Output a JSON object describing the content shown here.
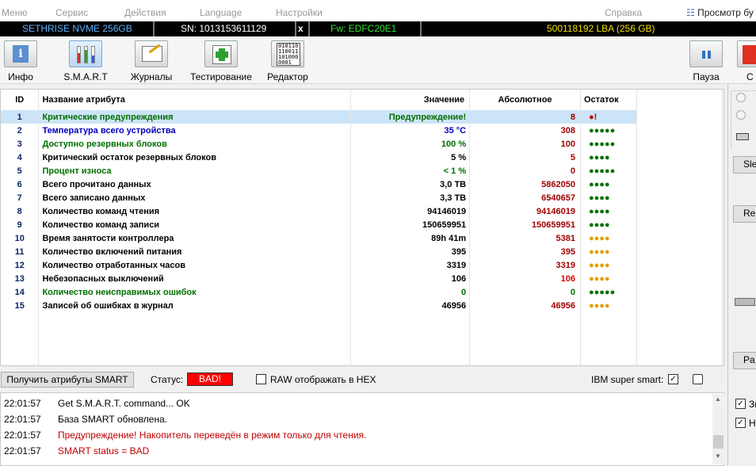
{
  "menu": {
    "items": [
      "Меню",
      "Сервис",
      "Действия",
      "Language",
      "Настройки"
    ],
    "help": "Справка",
    "view": "Просмотр бу"
  },
  "device": {
    "model": "SETHRISE NVME 256GB",
    "sn": "SN: 1013153611129",
    "close": "x",
    "fw": "Fw: EDFC20E1",
    "lba": "500118192 LBA (256 GB)"
  },
  "toolbar": {
    "info": "Инфо",
    "smart": "S.M.A.R.T",
    "journals": "Журналы",
    "testing": "Тестирование",
    "editor": "Редактор",
    "pause": "Пауза",
    "stop": "С"
  },
  "table": {
    "headers": {
      "id": "ID",
      "name": "Название атрибута",
      "value": "Значение",
      "abs": "Абсолютное",
      "rest": "Остаток"
    },
    "rows": [
      {
        "id": "1",
        "name": "Критические предупреждения",
        "value": "Предупреждение!",
        "abs": "8",
        "rest": "●!",
        "nc": "#007000",
        "vc": "#007000",
        "dc": "#c00000"
      },
      {
        "id": "2",
        "name": "Температура всего устройства",
        "value": "35 °C",
        "abs": "308",
        "rest": "●●●●●",
        "nc": "#0000c0",
        "vc": "#0000c0",
        "dc": "#007000"
      },
      {
        "id": "3",
        "name": "Доступно резервных блоков",
        "value": "100 %",
        "abs": "100",
        "rest": "●●●●●",
        "nc": "#007000",
        "vc": "#007000",
        "dc": "#007000"
      },
      {
        "id": "4",
        "name": "Критический остаток резервных блоков",
        "value": "5 %",
        "abs": "5",
        "rest": "●●●●",
        "nc": "#000",
        "vc": "#000",
        "dc": "#007000"
      },
      {
        "id": "5",
        "name": "Процент износа",
        "value": "< 1 %",
        "abs": "0",
        "rest": "●●●●●",
        "nc": "#007000",
        "vc": "#007000",
        "dc": "#007000"
      },
      {
        "id": "6",
        "name": "Всего прочитано данных",
        "value": "3,0 ТВ",
        "abs": "5862050",
        "rest": "●●●●",
        "nc": "#000",
        "vc": "#000",
        "dc": "#007000"
      },
      {
        "id": "7",
        "name": "Всего записано данных",
        "value": "3,3 ТВ",
        "abs": "6540657",
        "rest": "●●●●",
        "nc": "#000",
        "vc": "#000",
        "dc": "#007000"
      },
      {
        "id": "8",
        "name": "Количество команд чтения",
        "value": "94146019",
        "abs": "94146019",
        "rest": "●●●●",
        "nc": "#000",
        "vc": "#000",
        "dc": "#007000"
      },
      {
        "id": "9",
        "name": "Количество команд записи",
        "value": "150659951",
        "abs": "150659951",
        "rest": "●●●●",
        "nc": "#000",
        "vc": "#000",
        "dc": "#007000"
      },
      {
        "id": "10",
        "name": "Время занятости контроллера",
        "value": "89h 41m",
        "abs": "5381",
        "rest": "●●●●",
        "nc": "#000",
        "vc": "#000",
        "dc": "#e0a000"
      },
      {
        "id": "11",
        "name": "Количество включений питания",
        "value": "395",
        "abs": "395",
        "rest": "●●●●",
        "nc": "#000",
        "vc": "#000",
        "dc": "#e0a000"
      },
      {
        "id": "12",
        "name": "Количество отработанных часов",
        "value": "3319",
        "abs": "3319",
        "rest": "●●●●",
        "nc": "#000",
        "vc": "#000",
        "dc": "#e0a000"
      },
      {
        "id": "13",
        "name": "Небезопасных выключений",
        "value": "106",
        "abs": "106",
        "rest": "●●●●",
        "nc": "#000",
        "vc": "#000",
        "dc": "#e0a000",
        "ac": "#e00000"
      },
      {
        "id": "14",
        "name": "Количество неисправимых ошибок",
        "value": "0",
        "abs": "0",
        "rest": "●●●●●",
        "nc": "#007000",
        "vc": "#007000",
        "dc": "#007000",
        "ac": "#007000"
      },
      {
        "id": "15",
        "name": "Записей об ошибках в журнал",
        "value": "46956",
        "abs": "46956",
        "rest": "●●●●",
        "nc": "#000",
        "vc": "#000",
        "dc": "#e0a000"
      }
    ]
  },
  "status": {
    "get_button": "Получить атрибуты SMART",
    "label": "Статус:",
    "value": "BAD!",
    "raw_hex": "RAW отображать в HEX",
    "ibm": "IBM super smart:"
  },
  "log": [
    {
      "time": "22:01:57",
      "msg": "Get S.M.A.R.T. command... OK",
      "color": "#000"
    },
    {
      "time": "22:01:57",
      "msg": "База SMART обновлена.",
      "color": "#000"
    },
    {
      "time": "22:01:57",
      "msg": "Предупреждение! Накопитель переведён в режим только для чтения.",
      "color": "#c00000"
    },
    {
      "time": "22:01:57",
      "msg": "SMART status = BAD",
      "color": "#c00000"
    }
  ],
  "right": {
    "btn1": "Sle",
    "btn2": "Re",
    "btn3": "Pa",
    "chk1": "Зв",
    "chk2": "Н"
  },
  "colors": {
    "abs": "#a00000",
    "selected": "#cce4f7",
    "bad": "#ff0000"
  }
}
